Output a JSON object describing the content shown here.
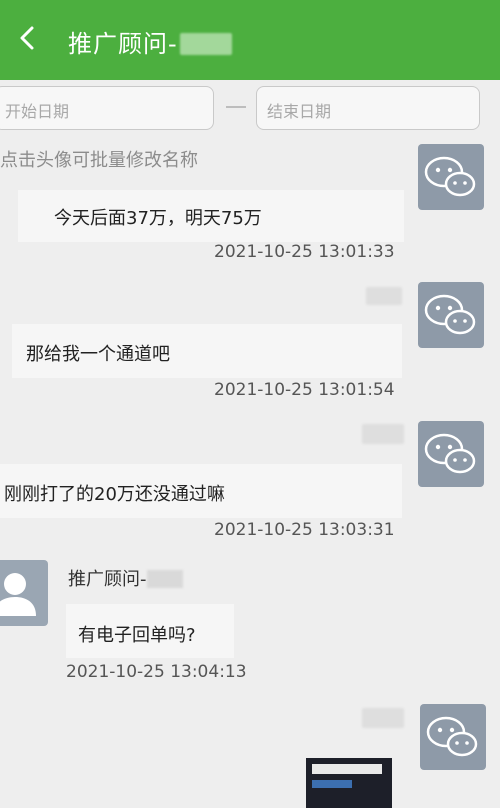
{
  "header": {
    "title": "推广顾问-"
  },
  "filter": {
    "start_placeholder": "开始日期",
    "end_placeholder": "结束日期"
  },
  "hint": "点击头像可批量修改名称",
  "messages": [
    {
      "side": "right",
      "text": "今天后面37万，明天75万",
      "time": "2021-10-25 13:01:33"
    },
    {
      "side": "right",
      "text": "那给我一个通道吧",
      "time": "2021-10-25 13:01:54"
    },
    {
      "side": "right",
      "text": "刚刚打了的20万还没通过嘛",
      "time": "2021-10-25 13:03:31"
    },
    {
      "side": "left",
      "sender": "推广顾问-",
      "text": "有电子回单吗?",
      "time": "2021-10-25 13:04:13"
    }
  ],
  "colors": {
    "header_bg": "#4caf3f",
    "avatar_wechat": "#8e9aa8",
    "page_bg": "#eeeeee"
  },
  "icons": {
    "back": "chevron-left-icon",
    "wechat": "wechat-icon",
    "user": "user-silhouette-icon"
  }
}
